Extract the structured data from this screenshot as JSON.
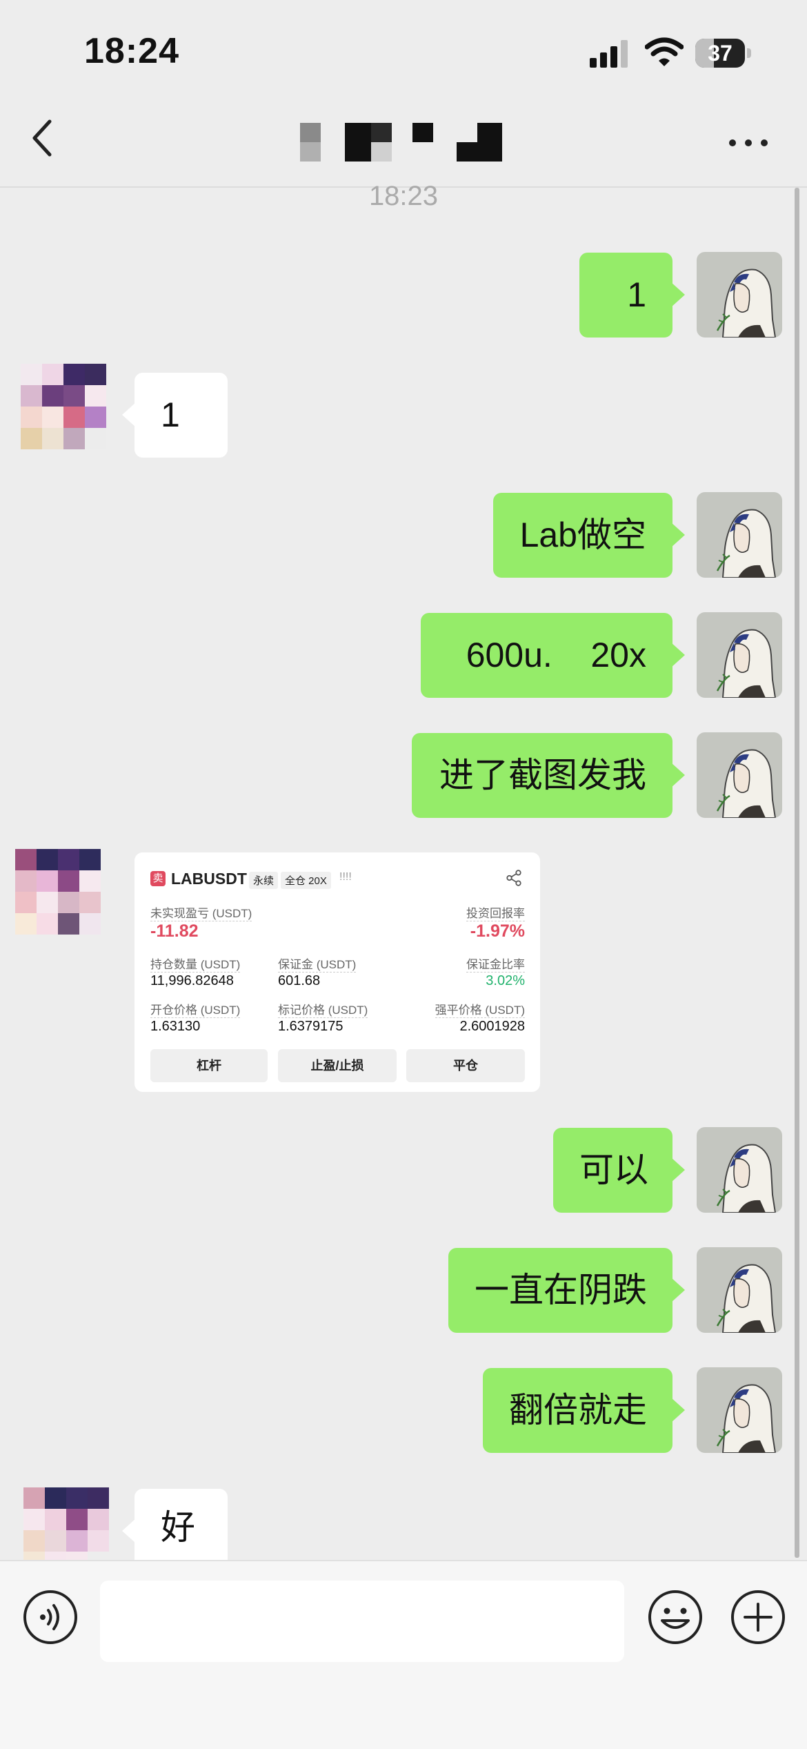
{
  "status_bar": {
    "time": "18:24",
    "battery": "37",
    "battery_level": 0.37
  },
  "nav": {
    "title_redacted": true
  },
  "time_divider": "18:23",
  "messages": [
    {
      "side": "sent",
      "text": "1"
    },
    {
      "side": "received",
      "text": "1"
    },
    {
      "side": "sent",
      "text": "Lab做空"
    },
    {
      "side": "sent",
      "text": "600u.    20x"
    },
    {
      "side": "sent",
      "text": "进了截图发我"
    },
    {
      "side": "received",
      "type": "image"
    },
    {
      "side": "sent",
      "text": "可以"
    },
    {
      "side": "sent",
      "text": "一直在阴跌"
    },
    {
      "side": "sent",
      "text": "翻倍就走"
    },
    {
      "side": "received",
      "text": "好"
    }
  ],
  "position_card": {
    "side_badge": "卖",
    "symbol": "LABUSDT",
    "contract_tag": "永续",
    "margin_tag": "全仓 20X",
    "bars": "!!!!",
    "unrealized_pnl_label": "未实现盈亏 (USDT)",
    "unrealized_pnl": "-11.82",
    "roi_label": "投资回报率",
    "roi": "-1.97%",
    "size_label": "持仓数量 (USDT)",
    "size": "11,996.82648",
    "margin_label": "保证金 (USDT)",
    "margin": "601.68",
    "margin_ratio_label": "保证金比率",
    "margin_ratio": "3.02%",
    "entry_label": "开仓价格 (USDT)",
    "entry": "1.63130",
    "mark_label": "标记价格 (USDT)",
    "mark": "1.6379175",
    "liq_label": "强平价格 (USDT)",
    "liq": "2.6001928",
    "buttons": [
      "杠杆",
      "止盈/止损",
      "平仓"
    ]
  },
  "colors": {
    "sent_bubble": "#95ec69",
    "received_bubble": "#ffffff",
    "background": "#ededed",
    "negative": "#e04a5f",
    "positive": "#20b26c"
  }
}
